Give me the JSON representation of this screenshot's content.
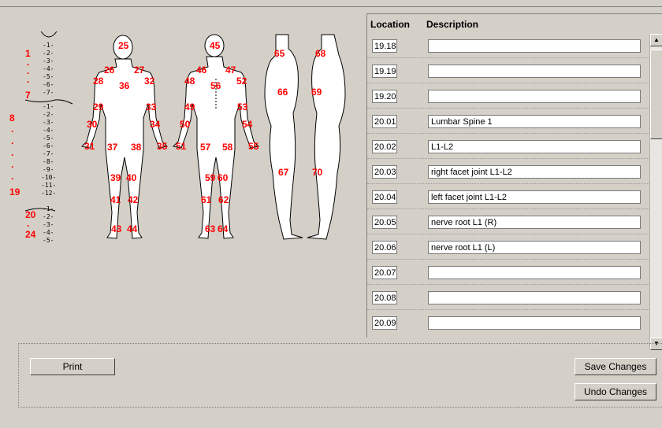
{
  "spine": {
    "numbers": [
      "1",
      "7",
      "8",
      "19",
      "20",
      "24"
    ],
    "ticks": [
      "1",
      "2",
      "3",
      "4",
      "5",
      "6",
      "7",
      "1",
      "2",
      "3",
      "4",
      "5",
      "6",
      "7",
      "8",
      "9",
      "10",
      "11",
      "12",
      "1",
      "2",
      "3",
      "4",
      "5"
    ]
  },
  "body_points": [
    "25",
    "26",
    "27",
    "28",
    "29",
    "30",
    "31",
    "32",
    "33",
    "34",
    "35",
    "36",
    "37",
    "38",
    "39",
    "40",
    "41",
    "42",
    "43",
    "44",
    "45",
    "46",
    "47",
    "48",
    "49",
    "50",
    "51",
    "52",
    "53",
    "54",
    "55",
    "56",
    "57",
    "58",
    "59",
    "60",
    "61",
    "62",
    "63",
    "64",
    "65",
    "66",
    "67",
    "68",
    "69",
    "70"
  ],
  "grid": {
    "headers": {
      "location": "Location",
      "description": "Description"
    },
    "rows": [
      {
        "location": "19.18",
        "description": ""
      },
      {
        "location": "19.19",
        "description": ""
      },
      {
        "location": "19.20",
        "description": ""
      },
      {
        "location": "20.01",
        "description": "Lumbar Spine 1"
      },
      {
        "location": "20.02",
        "description": "L1-L2"
      },
      {
        "location": "20.03",
        "description": "right facet joint L1-L2"
      },
      {
        "location": "20.04",
        "description": "left facet joint L1-L2"
      },
      {
        "location": "20.05",
        "description": "nerve root L1 (R)"
      },
      {
        "location": "20.06",
        "description": "nerve root L1 (L)"
      },
      {
        "location": "20.07",
        "description": ""
      },
      {
        "location": "20.08",
        "description": ""
      },
      {
        "location": "20.09",
        "description": ""
      }
    ]
  },
  "buttons": {
    "print": "Print",
    "save": "Save Changes",
    "undo": "Undo Changes"
  },
  "colors": {
    "background": "#d4d0c8",
    "marker": "#ff0000"
  }
}
